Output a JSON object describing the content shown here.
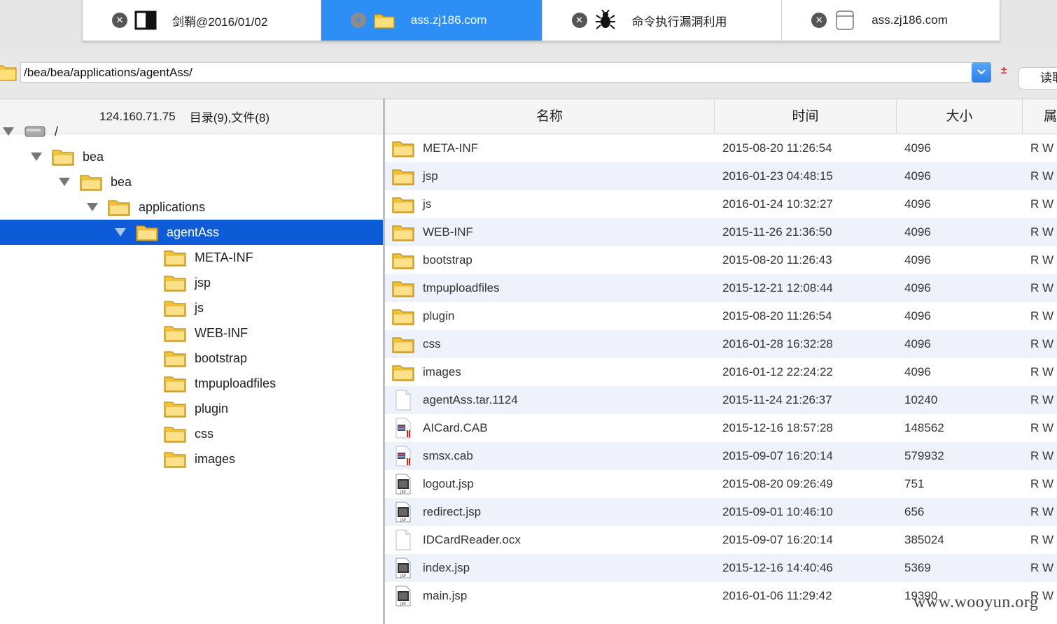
{
  "tabs": [
    {
      "label": "剑鞘@2016/01/02",
      "icon": "split-window-icon",
      "active": false
    },
    {
      "label": "ass.zj186.com",
      "icon": "folder-icon",
      "active": true
    },
    {
      "label": "命令执行漏洞利用",
      "icon": "bug-icon",
      "active": false
    },
    {
      "label": "ass.zj186.com",
      "icon": "database-icon",
      "active": false
    }
  ],
  "pathbar": {
    "path": "/bea/bea/applications/agentAss/",
    "plusminus": "±",
    "read_label": "读取"
  },
  "left": {
    "host_ip": "124.160.71.75",
    "summary": "目录(9),文件(8)",
    "tree": [
      {
        "label": "/",
        "icon": "drive-icon",
        "expanded": true,
        "selected": false
      },
      {
        "label": "bea",
        "icon": "folder-icon",
        "expanded": true,
        "selected": false
      },
      {
        "label": "bea",
        "icon": "folder-icon",
        "expanded": true,
        "selected": false
      },
      {
        "label": "applications",
        "icon": "folder-icon",
        "expanded": true,
        "selected": false
      },
      {
        "label": "agentAss",
        "icon": "folder-icon",
        "expanded": true,
        "selected": true
      },
      {
        "label": "META-INF",
        "icon": "folder-icon",
        "expanded": false,
        "selected": false
      },
      {
        "label": "jsp",
        "icon": "folder-icon",
        "expanded": false,
        "selected": false
      },
      {
        "label": "js",
        "icon": "folder-icon",
        "expanded": false,
        "selected": false
      },
      {
        "label": "WEB-INF",
        "icon": "folder-icon",
        "expanded": false,
        "selected": false
      },
      {
        "label": "bootstrap",
        "icon": "folder-icon",
        "expanded": false,
        "selected": false
      },
      {
        "label": "tmpuploadfiles",
        "icon": "folder-icon",
        "expanded": false,
        "selected": false
      },
      {
        "label": "plugin",
        "icon": "folder-icon",
        "expanded": false,
        "selected": false
      },
      {
        "label": "css",
        "icon": "folder-icon",
        "expanded": false,
        "selected": false
      },
      {
        "label": "images",
        "icon": "folder-icon",
        "expanded": false,
        "selected": false
      }
    ]
  },
  "columns": {
    "name": "名称",
    "time": "时间",
    "size": "大小",
    "attr": "属性"
  },
  "files": [
    {
      "name": "META-INF",
      "time": "2015-08-20 11:26:54",
      "size": "4096",
      "attr": "R W",
      "icon": "folder-icon"
    },
    {
      "name": "jsp",
      "time": "2016-01-23 04:48:15",
      "size": "4096",
      "attr": "R W",
      "icon": "folder-icon"
    },
    {
      "name": "js",
      "time": "2016-01-24 10:32:27",
      "size": "4096",
      "attr": "R W",
      "icon": "folder-icon"
    },
    {
      "name": "WEB-INF",
      "time": "2015-11-26 21:36:50",
      "size": "4096",
      "attr": "R W",
      "icon": "folder-icon"
    },
    {
      "name": "bootstrap",
      "time": "2015-08-20 11:26:43",
      "size": "4096",
      "attr": "R W",
      "icon": "folder-icon"
    },
    {
      "name": "tmpuploadfiles",
      "time": "2015-12-21 12:08:44",
      "size": "4096",
      "attr": "R W",
      "icon": "folder-icon"
    },
    {
      "name": "plugin",
      "time": "2015-08-20 11:26:54",
      "size": "4096",
      "attr": "R W",
      "icon": "folder-icon"
    },
    {
      "name": "css",
      "time": "2016-01-28 16:32:28",
      "size": "4096",
      "attr": "R W",
      "icon": "folder-icon"
    },
    {
      "name": "images",
      "time": "2016-01-12 22:24:22",
      "size": "4096",
      "attr": "R W",
      "icon": "folder-icon"
    },
    {
      "name": "agentAss.tar.1124",
      "time": "2015-11-24 21:26:37",
      "size": "10240",
      "attr": "R W",
      "icon": "blank-file-icon"
    },
    {
      "name": "AICard.CAB",
      "time": "2015-12-16 18:57:28",
      "size": "148562",
      "attr": "R W",
      "icon": "archive-file-icon"
    },
    {
      "name": "smsx.cab",
      "time": "2015-09-07 16:20:14",
      "size": "579932",
      "attr": "R W",
      "icon": "archive-file-icon"
    },
    {
      "name": "logout.jsp",
      "time": "2015-08-20 09:26:49",
      "size": "751",
      "attr": "R W",
      "icon": "jsp-file-icon"
    },
    {
      "name": "redirect.jsp",
      "time": "2015-09-01 10:46:10",
      "size": "656",
      "attr": "R W",
      "icon": "jsp-file-icon"
    },
    {
      "name": "IDCardReader.ocx",
      "time": "2015-09-07 16:20:14",
      "size": "385024",
      "attr": "R W",
      "icon": "blank-file-icon"
    },
    {
      "name": "index.jsp",
      "time": "2015-12-16 14:40:46",
      "size": "5369",
      "attr": "R W",
      "icon": "jsp-file-icon"
    },
    {
      "name": "main.jsp",
      "time": "2016-01-06 11:29:42",
      "size": "19390",
      "attr": "R W",
      "icon": "jsp-file-icon"
    }
  ],
  "watermark": "www.wooyun.org",
  "colors": {
    "accent": "#2d8ff5",
    "selection": "#0d5bd6",
    "row_alt": "#edf2fb",
    "folder": "#f3c33a"
  }
}
